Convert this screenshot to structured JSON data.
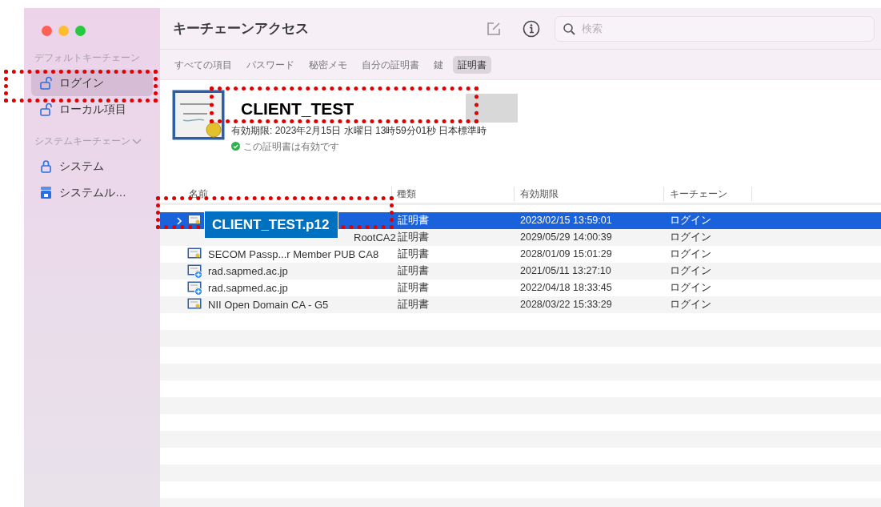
{
  "window": {
    "title": "キーチェーンアクセス"
  },
  "sidebar": {
    "sections": [
      {
        "header": "デフォルトキーチェーン",
        "collapsible": false,
        "items": [
          {
            "label": "ログイン",
            "kind": "unlocked",
            "selected": true
          },
          {
            "label": "ローカル項目",
            "kind": "unlocked",
            "selected": false
          }
        ]
      },
      {
        "header": "システムキーチェーン",
        "collapsible": true,
        "items": [
          {
            "label": "システム",
            "kind": "locked",
            "selected": false
          },
          {
            "label": "システムル…",
            "kind": "cabinet",
            "selected": false
          }
        ]
      }
    ]
  },
  "search": {
    "placeholder": "検索"
  },
  "tabs": [
    {
      "label": "すべての項目",
      "selected": false
    },
    {
      "label": "パスワード",
      "selected": false
    },
    {
      "label": "秘密メモ",
      "selected": false
    },
    {
      "label": "自分の証明書",
      "selected": false
    },
    {
      "label": "鍵",
      "selected": false
    },
    {
      "label": "証明書",
      "selected": true
    }
  ],
  "detail": {
    "title": "CLIENT_TEST",
    "expiry": "有効期限: 2023年2月15日 水曜日 13時59分01秒 日本標準時",
    "status": "この証明書は有効です",
    "valid": true
  },
  "table": {
    "columns": [
      "名前",
      "種類",
      "有効期限",
      "キーチェーン"
    ],
    "rows": [
      {
        "kind": "cert",
        "expandable": true,
        "selected": true,
        "type": "証明書",
        "expires": "2023/02/15 13:59:01",
        "keychain": "ログイン"
      },
      {
        "kind": "root",
        "expandable": false,
        "selected": false,
        "name": "RootCA2",
        "type": "証明書",
        "expires": "2029/05/29 14:00:39",
        "keychain": "ログイン"
      },
      {
        "kind": "cert",
        "expandable": false,
        "selected": false,
        "name": "SECOM Passp...r Member PUB CA8",
        "type": "証明書",
        "expires": "2028/01/09 15:01:29",
        "keychain": "ログイン"
      },
      {
        "kind": "plus",
        "expandable": false,
        "selected": false,
        "name": "rad.sapmed.ac.jp",
        "type": "証明書",
        "expires": "2021/05/11 13:27:10",
        "keychain": "ログイン"
      },
      {
        "kind": "plus",
        "expandable": false,
        "selected": false,
        "name": "rad.sapmed.ac.jp",
        "type": "証明書",
        "expires": "2022/04/18 18:33:45",
        "keychain": "ログイン"
      },
      {
        "kind": "cert",
        "expandable": false,
        "selected": false,
        "name": "NII Open Domain CA - G5",
        "type": "証明書",
        "expires": "2028/03/22 15:33:29",
        "keychain": "ログイン"
      }
    ]
  },
  "annotation": {
    "label": "CLIENT_TEST.p12"
  }
}
